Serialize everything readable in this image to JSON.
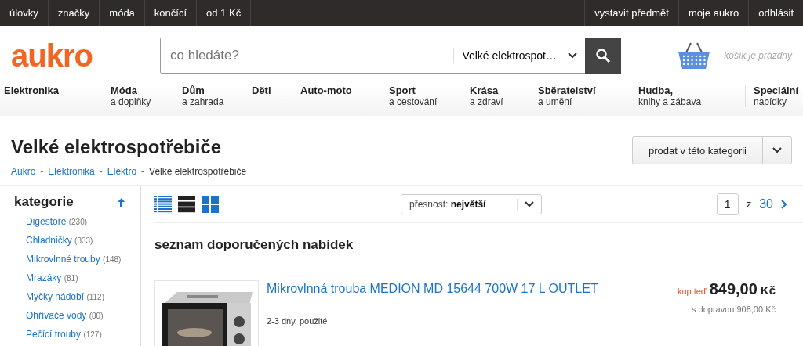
{
  "top_bar": {
    "left_links": [
      "úlovky",
      "značky",
      "móda",
      "končící",
      "od 1 Kč"
    ],
    "right_links": [
      "vystavit předmět",
      "moje aukro",
      "odhlásit"
    ]
  },
  "header": {
    "logo": "aukro",
    "search": {
      "placeholder": "co hledáte?",
      "category": "Velké elektrospot…"
    },
    "cart": "košík je prázdný"
  },
  "categories": [
    {
      "label": "Elektronika"
    },
    {
      "label": "Móda",
      "sublabel": "a doplňky"
    },
    {
      "label": "Dům",
      "sublabel": "a zahrada"
    },
    {
      "label": "Děti"
    },
    {
      "label": "Auto-moto"
    },
    {
      "label": "Sport",
      "sublabel": "a cestování"
    },
    {
      "label": "Krása",
      "sublabel": "a zdraví"
    },
    {
      "label": "Sběratelství",
      "sublabel": "a umění"
    },
    {
      "label": "Hudba,",
      "sublabel": "knihy a zábava"
    },
    {
      "label": "Speciální",
      "sublabel": "nabídky"
    }
  ],
  "page": {
    "title": "Velké elektrospotřebiče",
    "sell_button": "prodat v této kategorii",
    "breadcrumb_separator": "-",
    "breadcrumbs": [
      {
        "label": "Aukro",
        "kind": "link"
      },
      {
        "label": "Elektronika",
        "kind": "link"
      },
      {
        "label": "Elektro",
        "kind": "link"
      },
      {
        "label": "Velké elektrospotřebiče",
        "kind": "current"
      }
    ]
  },
  "sidebar": {
    "title": "kategorie",
    "items": [
      {
        "label": "Digestoře",
        "count": "(230)"
      },
      {
        "label": "Chladničky",
        "count": "(333)"
      },
      {
        "label": "Mikrovlnné trouby",
        "count": "(148)"
      },
      {
        "label": "Mrazáky",
        "count": "(81)"
      },
      {
        "label": "Myčky nádobí",
        "count": "(112)"
      },
      {
        "label": "Ohřívače vody",
        "count": "(80)"
      },
      {
        "label": "Pečící trouby",
        "count": "(127)"
      }
    ]
  },
  "toolbar": {
    "view_modes": [
      {
        "kind": "list"
      },
      {
        "kind": "rows"
      },
      {
        "kind": "grid"
      }
    ],
    "sort": {
      "label": "přesnost:",
      "value": "největší"
    },
    "pagination": {
      "page": "1",
      "separator": "z",
      "total": "30"
    }
  },
  "section_title": "seznam doporučených nabídek",
  "offers": [
    {
      "title": "Mikrovlnná trouba MEDION MD 15644 700W 17 L OUTLET",
      "details": "2-3 dny, použité",
      "buy_label": "kup teď",
      "price": "849,00",
      "currency": "Kč",
      "shipping": "s dopravou 908,00 Kč"
    }
  ]
}
